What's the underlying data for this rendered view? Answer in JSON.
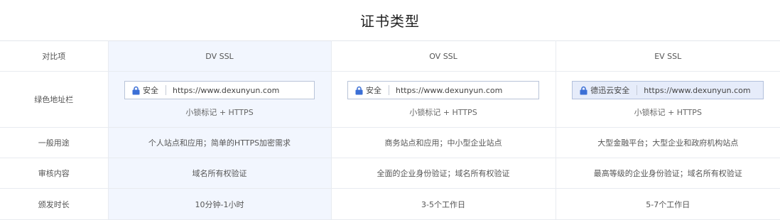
{
  "title": "证书类型",
  "header": {
    "label": "对比项",
    "columns": [
      "DV SSL",
      "OV SSL",
      "EV SSL"
    ]
  },
  "address_bar": {
    "label": "绿色地址栏",
    "items": [
      {
        "badge": "安全",
        "url": "https://www.dexunyun.com",
        "caption": "小锁标记 + HTTPS"
      },
      {
        "badge": "安全",
        "url": "https://www.dexunyun.com",
        "caption": "小锁标记 + HTTPS"
      },
      {
        "badge": "德迅云安全",
        "url": "https://www.dexunyun.com",
        "caption": "小锁标记 + HTTPS"
      }
    ]
  },
  "rows": [
    {
      "label": "一般用途",
      "values": [
        "个人站点和应用；简单的HTTPS加密需求",
        "商务站点和应用；中小型企业站点",
        "大型金融平台；大型企业和政府机构站点"
      ]
    },
    {
      "label": "审核内容",
      "values": [
        "域名所有权验证",
        "全面的企业身份验证；域名所有权验证",
        "最高等级的企业身份验证；域名所有权验证"
      ]
    },
    {
      "label": "颁发时长",
      "values": [
        "10分钟-1小时",
        "3-5个工作日",
        "5-7个工作日"
      ]
    }
  ],
  "colors": {
    "highlight": "#f2f6fe",
    "lock": "#3b6fd6",
    "border": "#e8ebf0"
  }
}
